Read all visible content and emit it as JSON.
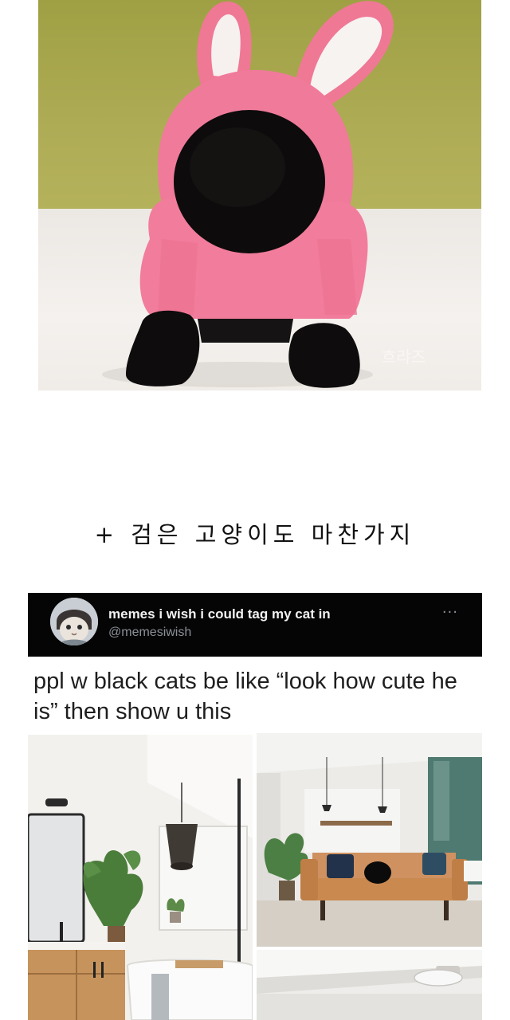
{
  "caption": "+ 검은 고양이도 마찬가지",
  "tweet": {
    "display_name": "memes i wish i could tag my cat in",
    "handle": "@memesiwish",
    "more_label": "···",
    "text": "ppl w black cats be like “look how cute he is” then show u this"
  },
  "photo_top": {
    "watermark": "흐랴즈"
  },
  "icons": {
    "more": "more-options-icon"
  },
  "colors": {
    "tweet_bar": "#050505",
    "hoodie_pink": "#f07a9a",
    "wall_olive": "#a7a44a",
    "sofa_tan": "#c98a5a"
  }
}
